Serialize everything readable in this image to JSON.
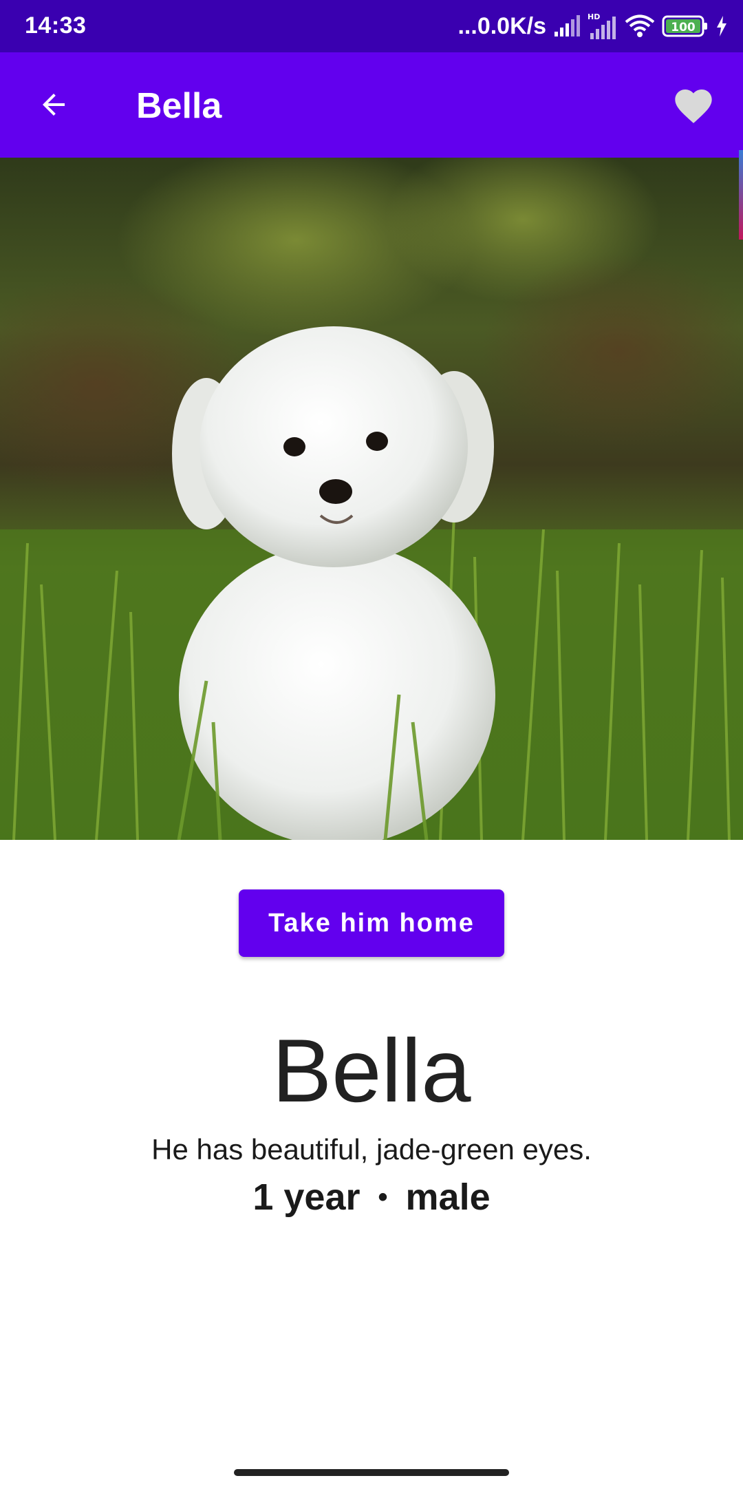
{
  "status_bar": {
    "time": "14:33",
    "network_speed": "...0.0K/s",
    "battery_level": "100",
    "icons": [
      "signal-icon",
      "hd-signal-icon",
      "wifi-icon",
      "battery-icon",
      "charging-icon"
    ]
  },
  "app_bar": {
    "title": "Bella",
    "back_icon": "arrow-back-icon",
    "favorite_icon": "heart-icon"
  },
  "pet": {
    "name": "Bella",
    "description": "He has beautiful, jade-green eyes.",
    "age": "1 year",
    "separator": "•",
    "gender": "male",
    "photo": "white-puppy-in-grass"
  },
  "actions": {
    "adopt_label": "Take him home"
  },
  "colors": {
    "status_bar": "#3a00b0",
    "primary": "#6200ee",
    "favorite_icon": "#d9d9d9"
  }
}
